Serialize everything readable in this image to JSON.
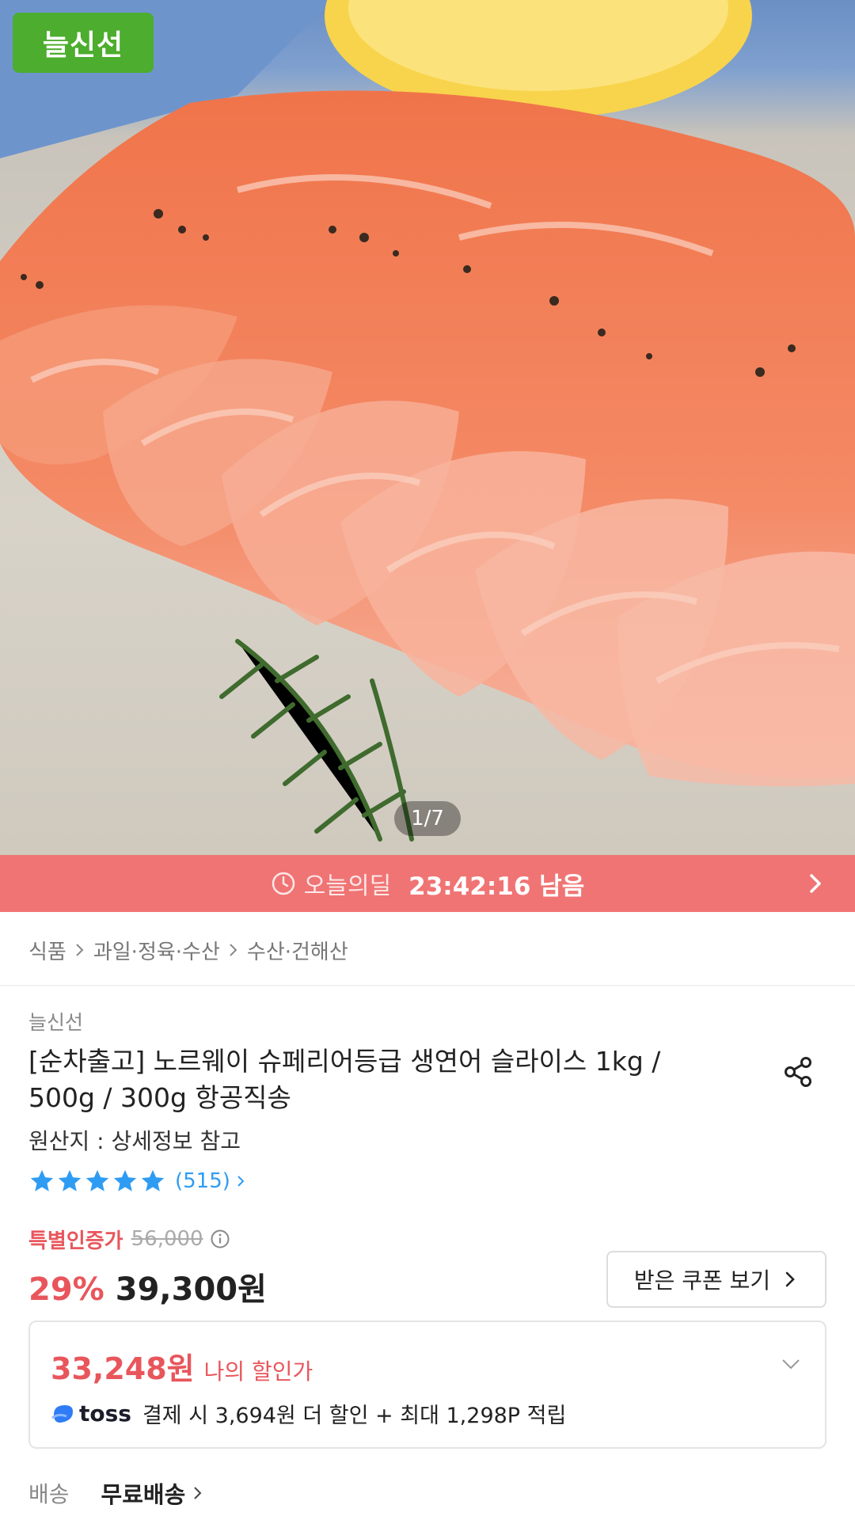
{
  "hero": {
    "brand_badge": "늘신선",
    "image_counter": "1/7",
    "image_description_icon": "salmon-photo"
  },
  "deal": {
    "label": "오늘의딜",
    "time_left": "23:42:16 남음",
    "bar_color": "#f07474"
  },
  "breadcrumb": [
    "식품",
    "과일·정육·수산",
    "수산·건해산"
  ],
  "product": {
    "seller": "늘신선",
    "title_line1": "[순차출고] 노르웨이 슈페리어등급 생연어 슬라이스 1kg /",
    "title_line2": "500g / 300g 항공직송",
    "origin": "원산지 : 상세정보 참고",
    "rating_stars": 5,
    "review_count": "(515)"
  },
  "pricing": {
    "special_label": "특별인증가",
    "original_price": "56,000",
    "discount_rate": "29%",
    "price": "39,300원",
    "coupon_button": "받은 쿠폰 보기",
    "my_price": "33,248원",
    "my_price_label": "나의 할인가",
    "toss_brand": "toss",
    "toss_desc": "결제 시 3,694원 더 할인 + 최대 1,298P 적립",
    "accent_color": "#e8565c"
  },
  "shipping": {
    "label": "배송",
    "value": "무료배송"
  }
}
